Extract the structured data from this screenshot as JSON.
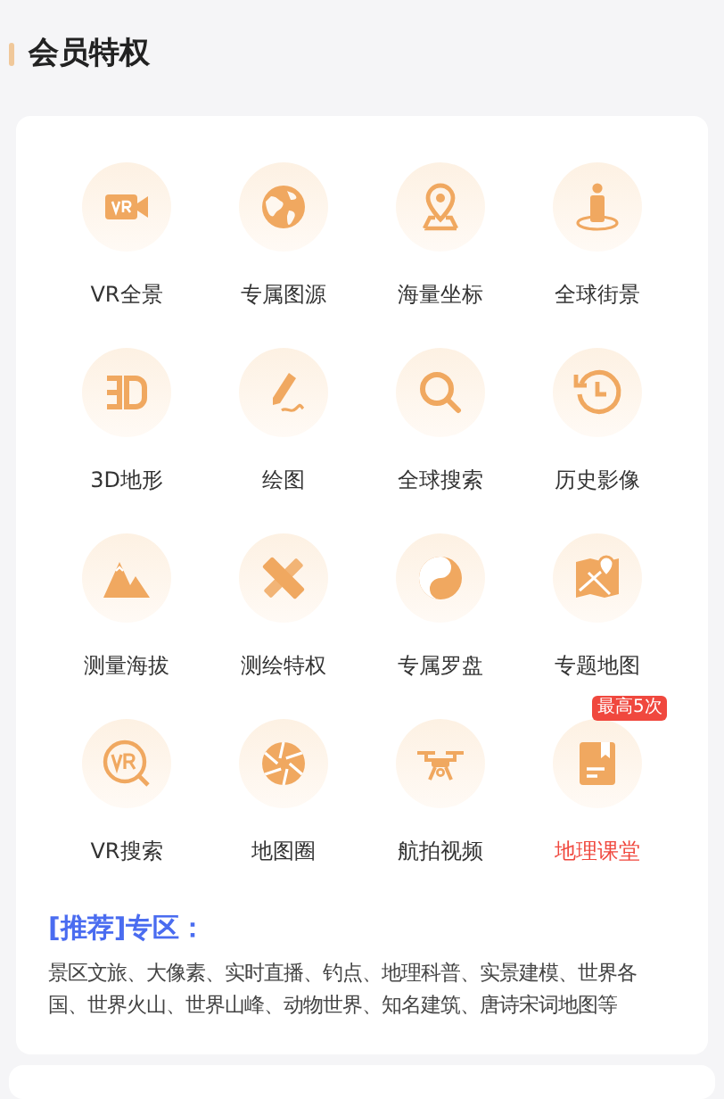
{
  "section": {
    "title": "会员特权"
  },
  "features": [
    {
      "kind": "vr-camera",
      "label": "VR全景",
      "highlighted": false,
      "badged": false
    },
    {
      "kind": "globe",
      "label": "专属图源",
      "highlighted": false,
      "badged": false
    },
    {
      "kind": "pin",
      "label": "海量坐标",
      "highlighted": false,
      "badged": false
    },
    {
      "kind": "person",
      "label": "全球街景",
      "highlighted": false,
      "badged": false
    },
    {
      "kind": "terrain",
      "label": "3D地形",
      "highlighted": false,
      "badged": false
    },
    {
      "kind": "pen",
      "label": "绘图",
      "highlighted": false,
      "badged": false
    },
    {
      "kind": "search",
      "label": "全球搜索",
      "highlighted": false,
      "badged": false
    },
    {
      "kind": "history",
      "label": "历史影像",
      "highlighted": false,
      "badged": false
    },
    {
      "kind": "mountain",
      "label": "测量海拔",
      "highlighted": false,
      "badged": false
    },
    {
      "kind": "ruler",
      "label": "测绘特权",
      "highlighted": false,
      "badged": false
    },
    {
      "kind": "yinyang",
      "label": "专属罗盘",
      "highlighted": false,
      "badged": false
    },
    {
      "kind": "map",
      "label": "专题地图",
      "highlighted": false,
      "badged": false
    },
    {
      "kind": "vr-search",
      "label": "VR搜索",
      "highlighted": false,
      "badged": false
    },
    {
      "kind": "aperture",
      "label": "地图圈",
      "highlighted": false,
      "badged": false
    },
    {
      "kind": "drone",
      "label": "航拍视频",
      "highlighted": false,
      "badged": false
    },
    {
      "kind": "book",
      "label": "地理课堂",
      "highlighted": true,
      "badged": true
    }
  ],
  "limit_badge": {
    "text": "最高5次"
  },
  "recommend": {
    "title": "[推荐]专区：",
    "text": "景区文旅、大像素、实时直播、钓点、地理科普、实景建模、世界各国、世界火山、世界山峰、动物世界、知名建筑、唐诗宋词地图等"
  }
}
